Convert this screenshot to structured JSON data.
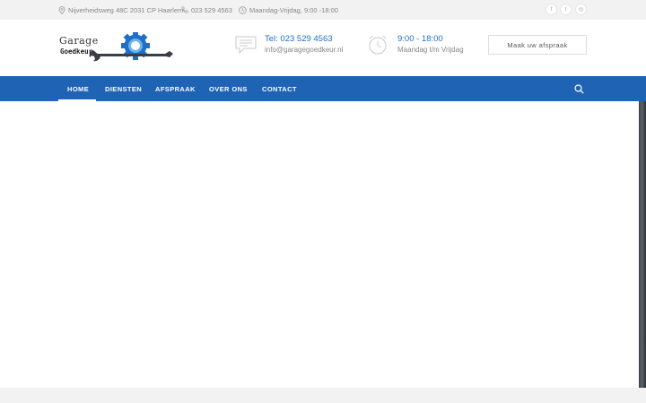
{
  "topbar": {
    "address": "Nijverheidsweg 48C 2031 CP Haarlem",
    "phone": "023 529 4563",
    "hours": "Maandag-Vrijdag, 9:00 -18:00",
    "social": [
      {
        "icon": "facebook-icon",
        "glyph": "f"
      },
      {
        "icon": "twitter-icon",
        "glyph": "t"
      },
      {
        "icon": "instagram-icon",
        "glyph": "◎"
      }
    ]
  },
  "logo": {
    "line1": "Garage",
    "line2": "Goedkeur"
  },
  "contact": {
    "title": "Tel: 023 529 4563",
    "sub": "info@garagegoedkeur.nl"
  },
  "openinghours": {
    "title": "9:00 - 18:00",
    "sub": "Maandag t/m Vrijdag"
  },
  "cta": {
    "label": "Maak uw afspraak"
  },
  "nav": {
    "items": [
      "HOME",
      "DIENSTEN",
      "AFSPRAAK",
      "OVER ONS",
      "CONTACT"
    ],
    "active": "HOME"
  },
  "colors": {
    "brand": "#1f63b5",
    "accent": "#1f6fc5",
    "topbar": "#f2f2f2"
  }
}
